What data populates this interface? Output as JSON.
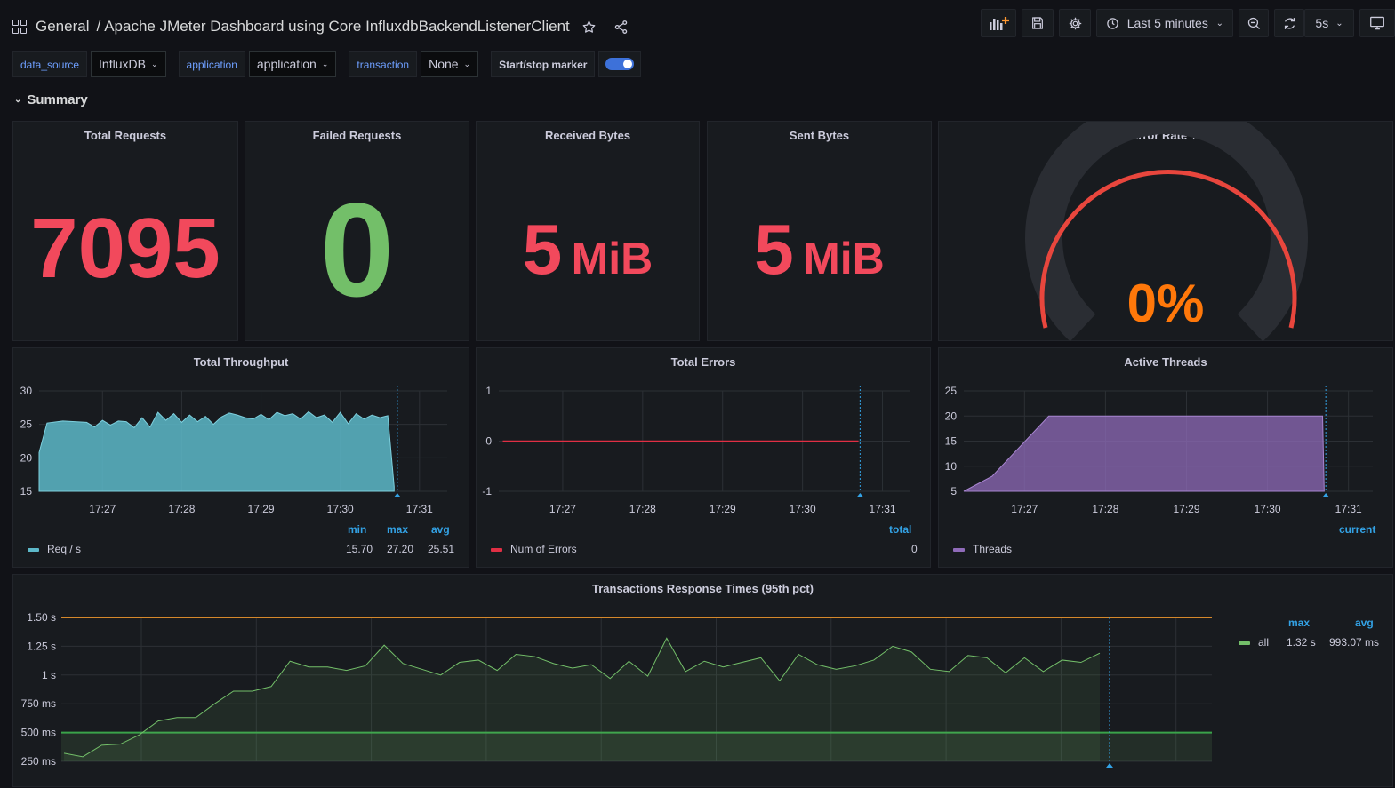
{
  "header": {
    "breadcrumb_root": "General",
    "breadcrumb_sep": "/",
    "dashboard_title": "Apache JMeter Dashboard using Core InfluxdbBackendListenerClient",
    "time_range": "Last 5 minutes",
    "refresh_interval": "5s"
  },
  "variables": [
    {
      "label": "data_source",
      "value": "InfluxDB"
    },
    {
      "label": "application",
      "value": "application"
    },
    {
      "label": "transaction",
      "value": "None"
    }
  ],
  "marker": {
    "label": "Start/stop marker",
    "enabled": true
  },
  "row": {
    "title": "Summary"
  },
  "stats": {
    "total_requests": {
      "title": "Total Requests",
      "value": "7095",
      "color": "#f2495c"
    },
    "failed_requests": {
      "title": "Failed Requests",
      "value": "0",
      "color": "#73bf69"
    },
    "received_bytes": {
      "title": "Received Bytes",
      "value": "5",
      "unit": "MiB",
      "color": "#f2495c"
    },
    "sent_bytes": {
      "title": "Sent Bytes",
      "value": "5",
      "unit": "MiB",
      "color": "#f2495c"
    },
    "error_rate": {
      "title": "Error Rate %",
      "value": "0%",
      "fraction": 0,
      "color": "#ff780a",
      "arc_color": "#f2495c"
    }
  },
  "panels": {
    "throughput": {
      "title": "Total Throughput",
      "legend_headers": [
        "min",
        "max",
        "avg"
      ],
      "legend": {
        "name": "Req / s",
        "values": [
          "15.70",
          "27.20",
          "25.51"
        ],
        "color": "#5db8c9"
      }
    },
    "errors": {
      "title": "Total Errors",
      "legend_headers": [
        "total"
      ],
      "legend": {
        "name": "Num of Errors",
        "values": [
          "0"
        ],
        "color": "#e02f44"
      }
    },
    "threads": {
      "title": "Active Threads",
      "legend_headers": [
        "current"
      ],
      "legend": {
        "name": "Threads",
        "values": [],
        "color": "#8f6bb9"
      }
    },
    "response": {
      "title": "Transactions Response Times (95th pct)",
      "legend_headers": [
        "max",
        "avg"
      ],
      "legend": {
        "name": "all",
        "values": [
          "1.32 s",
          "993.07 ms"
        ],
        "color": "#73bf69"
      }
    }
  },
  "chart_data": [
    {
      "type": "area",
      "title": "Total Throughput",
      "x_ticks": [
        "17:27",
        "17:28",
        "17:29",
        "17:30",
        "17:31"
      ],
      "y_ticks": [
        "15",
        "20",
        "25",
        "30"
      ],
      "ylim": [
        15,
        30
      ],
      "x_range_min": [
        26.2,
        31.3
      ],
      "series": [
        {
          "name": "Req / s",
          "x": [
            26.2,
            26.3,
            26.5,
            26.8,
            26.9,
            27.0,
            27.1,
            27.2,
            27.3,
            27.4,
            27.5,
            27.6,
            27.7,
            27.8,
            27.9,
            28.0,
            28.1,
            28.2,
            28.3,
            28.4,
            28.5,
            28.6,
            28.7,
            28.8,
            28.9,
            29.0,
            29.1,
            29.2,
            29.3,
            29.4,
            29.5,
            29.6,
            29.7,
            29.8,
            29.9,
            30.0,
            30.1,
            30.2,
            30.3,
            30.4,
            30.5,
            30.6,
            30.68
          ],
          "y": [
            20.8,
            25.2,
            25.5,
            25.3,
            24.6,
            25.6,
            24.9,
            25.5,
            25.4,
            24.5,
            26.0,
            24.6,
            26.8,
            25.6,
            26.6,
            25.3,
            26.4,
            25.4,
            26.2,
            25.0,
            26.1,
            26.7,
            26.4,
            26.0,
            25.8,
            26.5,
            25.7,
            26.8,
            26.3,
            26.6,
            25.8,
            26.9,
            26.0,
            26.4,
            25.3,
            26.8,
            25.1,
            26.6,
            25.8,
            26.4,
            26.0,
            26.3,
            15.7
          ]
        }
      ]
    },
    {
      "type": "line",
      "title": "Total Errors",
      "x_ticks": [
        "17:27",
        "17:28",
        "17:29",
        "17:30",
        "17:31"
      ],
      "y_ticks": [
        "-1",
        "0",
        "1"
      ],
      "ylim": [
        -1,
        1
      ],
      "series": [
        {
          "name": "Num of Errors",
          "x": [
            26.25,
            30.7
          ],
          "y": [
            0,
            0
          ]
        }
      ]
    },
    {
      "type": "area",
      "title": "Active Threads",
      "x_ticks": [
        "17:27",
        "17:28",
        "17:29",
        "17:30",
        "17:31"
      ],
      "y_ticks": [
        "5",
        "10",
        "15",
        "20",
        "25"
      ],
      "ylim": [
        5,
        25
      ],
      "series": [
        {
          "name": "Threads",
          "x": [
            26.25,
            26.6,
            27.3,
            30.68,
            30.7
          ],
          "y": [
            5,
            8,
            20,
            20,
            5
          ]
        }
      ]
    },
    {
      "type": "area",
      "title": "Transactions Response Times (95th pct)",
      "y_ticks": [
        "250 ms",
        "500 ms",
        "750 ms",
        "1 s",
        "1.25 s",
        "1.50 s"
      ],
      "ylim": [
        0.25,
        1.5
      ],
      "thresholds": [
        0.5,
        1.5
      ],
      "series": [
        {
          "name": "all",
          "y": [
            0.32,
            0.29,
            0.39,
            0.4,
            0.48,
            0.6,
            0.63,
            0.63,
            0.75,
            0.86,
            0.86,
            0.9,
            1.12,
            1.07,
            1.07,
            1.04,
            1.08,
            1.26,
            1.1,
            1.05,
            1.0,
            1.11,
            1.13,
            1.04,
            1.18,
            1.16,
            1.1,
            1.06,
            1.09,
            0.97,
            1.12,
            0.99,
            1.32,
            1.03,
            1.12,
            1.07,
            1.11,
            1.15,
            0.95,
            1.18,
            1.09,
            1.05,
            1.08,
            1.13,
            1.25,
            1.2,
            1.05,
            1.03,
            1.17,
            1.15,
            1.02,
            1.15,
            1.03,
            1.13,
            1.11,
            1.19
          ]
        }
      ]
    }
  ]
}
